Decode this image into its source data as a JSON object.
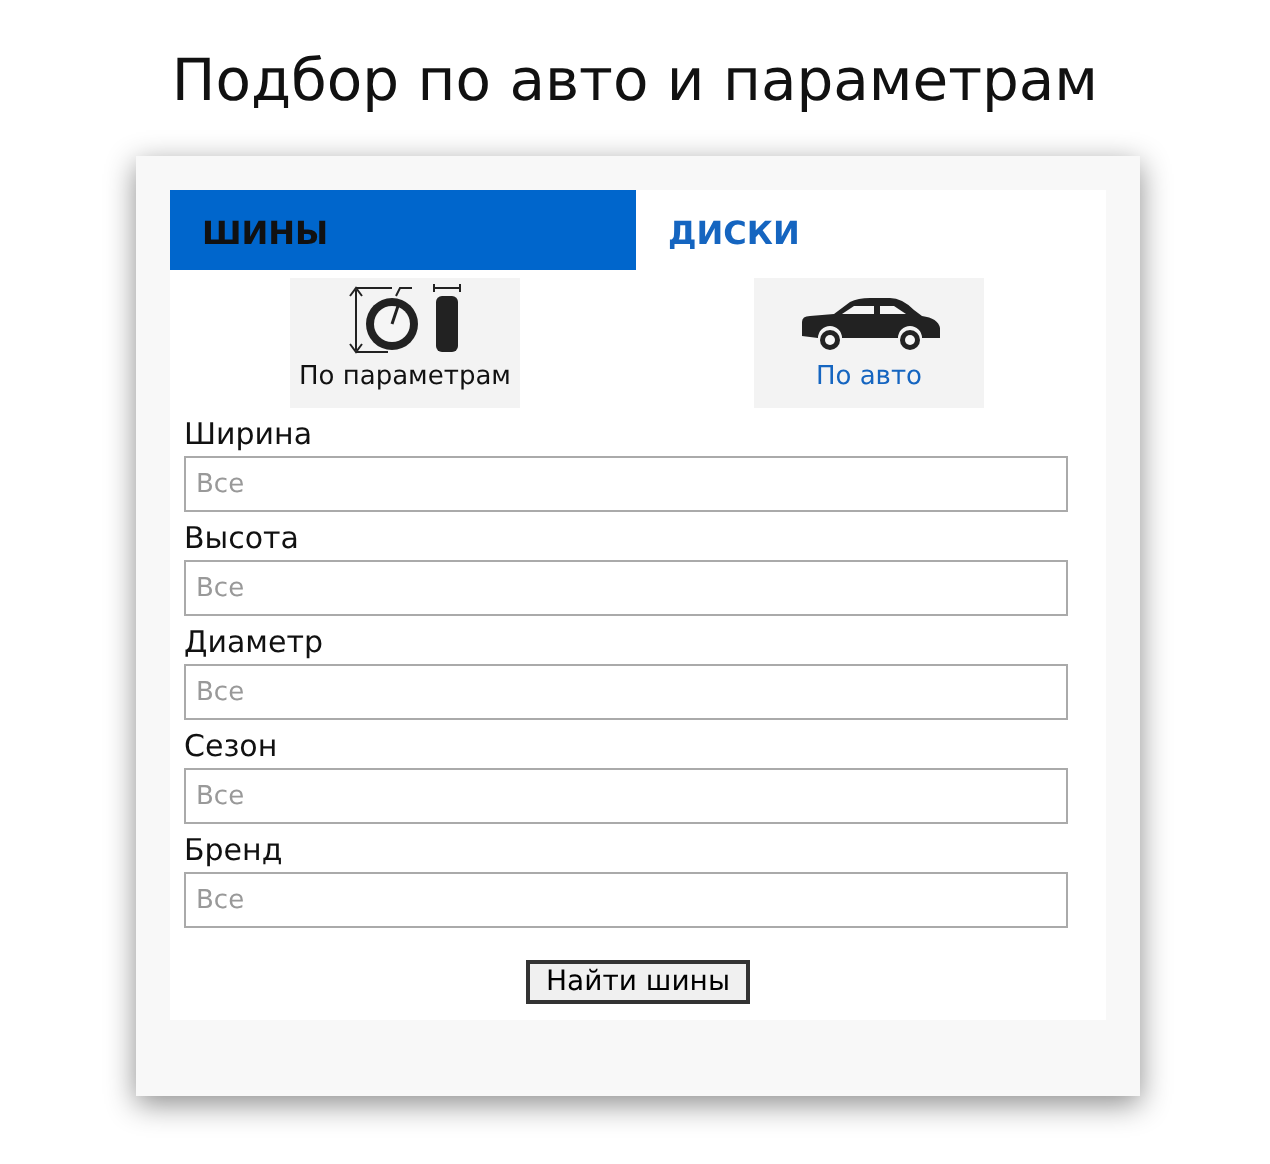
{
  "title": "Подбор по авто и параметрам",
  "tabs": [
    {
      "label": "ШИНЫ",
      "selected": true
    },
    {
      "label": "ДИСКИ",
      "selected": false
    }
  ],
  "modes": [
    {
      "kind": "tire",
      "label": "По параметрам",
      "selected": true
    },
    {
      "kind": "car",
      "label": "По авто",
      "selected": false
    }
  ],
  "fields": [
    {
      "label": "Ширина",
      "placeholder": "Все"
    },
    {
      "label": "Высота",
      "placeholder": "Все"
    },
    {
      "label": "Диаметр",
      "placeholder": "Все"
    },
    {
      "label": "Сезон",
      "placeholder": "Все"
    },
    {
      "label": "Бренд",
      "placeholder": "Все"
    }
  ],
  "submit": "Найти шины"
}
